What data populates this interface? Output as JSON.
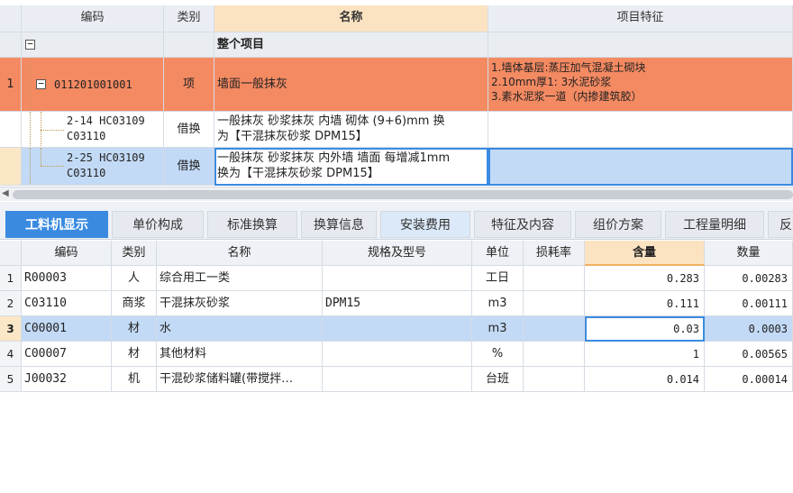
{
  "top_grid": {
    "headers": {
      "code": "编码",
      "type": "类别",
      "name": "名称",
      "feature": "项目特征"
    },
    "rows": [
      {
        "num": "",
        "code": "",
        "type": "",
        "name": "整个项目",
        "feature": [],
        "expander": "−"
      },
      {
        "num": "1",
        "code": "011201001001",
        "type": "项",
        "name": "墙面一般抹灰",
        "feature": [
          "1.墙体基层:蒸压加气混凝土砌块",
          "2.10mm厚1: 3水泥砂浆",
          "3.素水泥浆一道（内掺建筑胶）"
        ],
        "expander": "−"
      },
      {
        "num": "",
        "code": [
          "2-14 HC03109",
          "C03110"
        ],
        "type": "借换",
        "name": [
          "一般抹灰 砂浆抹灰 内墙 砌体 (9+6)mm  换",
          "为【干混抹灰砂浆 DPM15】"
        ],
        "feature": []
      },
      {
        "num": "",
        "code": [
          "2-25 HC03109",
          "C03110"
        ],
        "type": "借换",
        "name": [
          "一般抹灰 砂浆抹灰 内外墙 墙面 每增减1mm",
          " 换为【干混抹灰砂浆 DPM15】"
        ],
        "feature": []
      }
    ]
  },
  "tabs": [
    "工料机显示",
    "单价构成",
    "标准换算",
    "换算信息",
    "安装费用",
    "特征及内容",
    "组价方案",
    "工程量明细",
    "反"
  ],
  "bottom_grid": {
    "headers": {
      "code": "编码",
      "type": "类别",
      "name": "名称",
      "spec": "规格及型号",
      "unit": "单位",
      "loss": "损耗率",
      "content": "含量",
      "qty": "数量"
    },
    "rows": [
      {
        "num": "1",
        "code": "R00003",
        "type": "人",
        "name": "综合用工一类",
        "spec": "",
        "unit": "工日",
        "loss": "",
        "content": "0.283",
        "qty": "0.00283"
      },
      {
        "num": "2",
        "code": "C03110",
        "type": "商浆",
        "name": "干混抹灰砂浆",
        "spec": "DPM15",
        "unit": "m3",
        "loss": "",
        "content": "0.111",
        "qty": "0.00111"
      },
      {
        "num": "3",
        "code": "C00001",
        "type": "材",
        "name": "水",
        "spec": "",
        "unit": "m3",
        "loss": "",
        "content": "0.03",
        "qty": "0.0003"
      },
      {
        "num": "4",
        "code": "C00007",
        "type": "材",
        "name": "其他材料",
        "spec": "",
        "unit": "%",
        "loss": "",
        "content": "1",
        "qty": "0.00565"
      },
      {
        "num": "5",
        "code": "J00032",
        "type": "机",
        "name": "干混砂浆储料罐(带搅拌…",
        "spec": "",
        "unit": "台班",
        "loss": "",
        "content": "0.014",
        "qty": "0.00014"
      }
    ]
  },
  "colors": {
    "accent": "#3a8be0",
    "main_row": "#f48a62",
    "selected_row": "#c3daf6",
    "selected_header": "#fbe3c2"
  }
}
